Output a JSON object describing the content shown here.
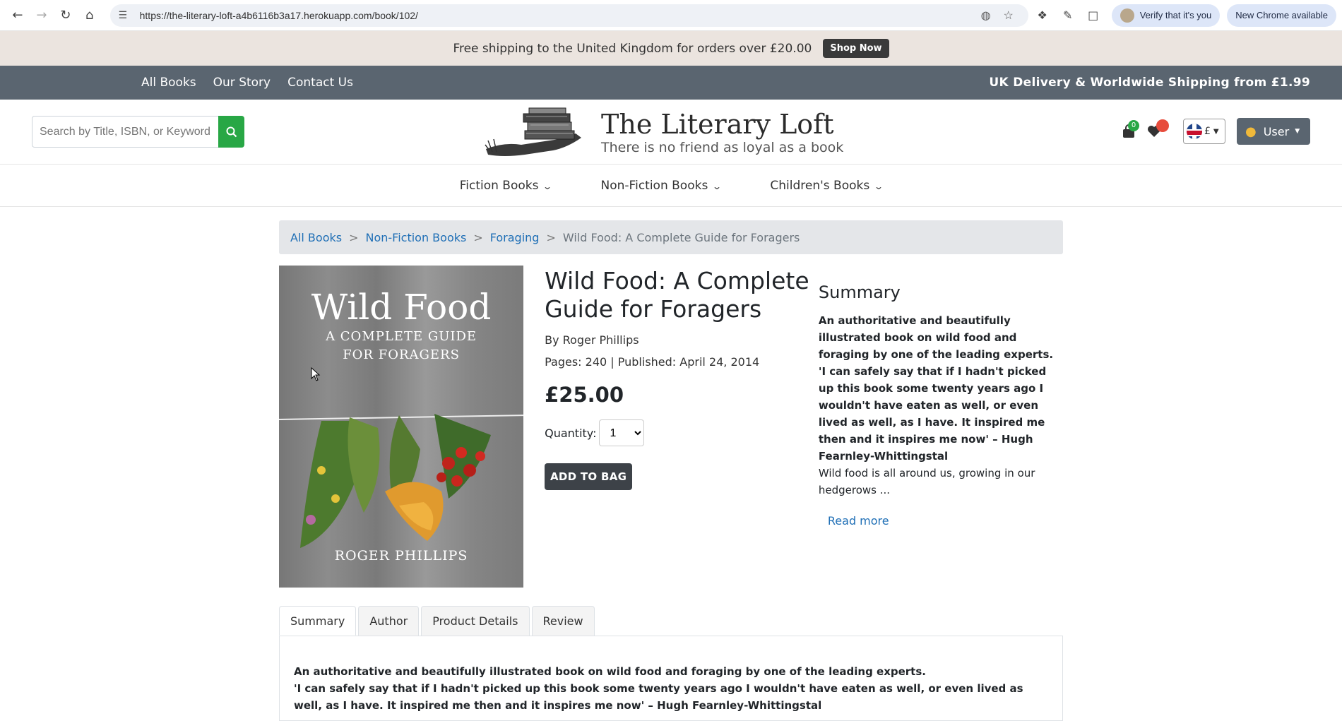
{
  "browser": {
    "url": "https://the-literary-loft-a4b6116b3a17.herokuapp.com/book/102/",
    "verify_label": "Verify that it's you",
    "update_label": "New Chrome available"
  },
  "promo": {
    "text": "Free shipping to the United Kingdom for orders over £20.00",
    "button": "Shop Now"
  },
  "topnav": {
    "links": [
      "All Books",
      "Our Story",
      "Contact Us"
    ],
    "shipping": "UK Delivery & Worldwide Shipping from £1.99"
  },
  "header": {
    "search_placeholder": "Search by Title, ISBN, or Keyword",
    "title": "The Literary Loft",
    "tagline": "There is no friend as loyal as a book",
    "bag_count": "0",
    "currency": "£",
    "user_label": "User"
  },
  "categories": [
    "Fiction Books",
    "Non-Fiction Books",
    "Children's Books"
  ],
  "breadcrumb": {
    "items": [
      "All Books",
      "Non-Fiction Books",
      "Foraging"
    ],
    "current": "Wild Food: A Complete Guide for Foragers"
  },
  "book": {
    "cover_title": "Wild Food",
    "cover_subtitle_1": "A COMPLETE GUIDE",
    "cover_subtitle_2": "FOR FORAGERS",
    "cover_author": "ROGER PHILLIPS",
    "title": "Wild Food: A Complete Guide for Foragers",
    "author": "By Roger Phillips",
    "meta": "Pages: 240 | Published: April 24, 2014",
    "price": "£25.00",
    "quantity_label": "Quantity:",
    "quantity_value": "1",
    "add_button": "ADD TO BAG"
  },
  "summary": {
    "heading": "Summary",
    "bold_1": "An authoritative and beautifully illustrated book on wild food and foraging by one of the leading experts.",
    "bold_2": "'I can safely say that if I hadn't picked up this book some twenty years ago I wouldn't have eaten as well, or even lived as well, as I have. It inspired me then and it inspires me now' – Hugh Fearnley-Whittingstal",
    "normal": "Wild food is all around us, growing in our hedgerows ...",
    "read_more": "Read more"
  },
  "tabs": [
    "Summary",
    "Author",
    "Product Details",
    "Review"
  ],
  "tab_body": {
    "line1": "An authoritative and beautifully illustrated book on wild food and foraging by one of the leading experts.",
    "line2": "'I can safely say that if I hadn't picked up this book some twenty years ago I wouldn't have eaten as well, or even lived as well, as I have. It inspired me then and it inspires me now' – Hugh Fearnley-Whittingstal"
  }
}
